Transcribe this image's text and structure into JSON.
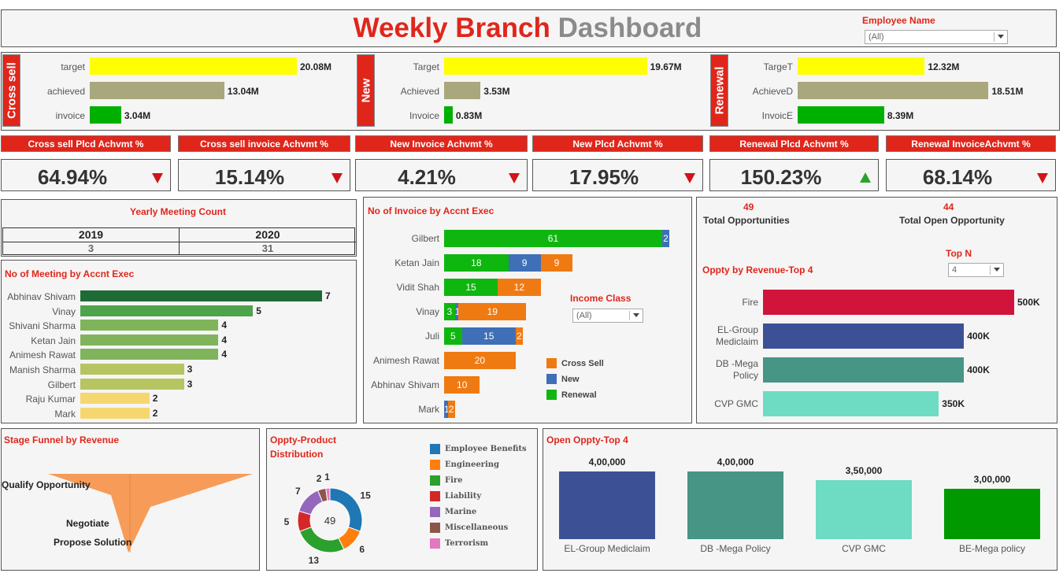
{
  "header": {
    "title_part1": "Weekly Branch",
    "title_part2": "Dashboard",
    "employee_label": "Employee Name",
    "employee_value": "(All)"
  },
  "groups": [
    {
      "label": "Cross sell",
      "rows": [
        {
          "name": "target",
          "value": "20.08M",
          "color": "#ffff00",
          "amount": 20.08
        },
        {
          "name": "achieved",
          "value": "13.04M",
          "color": "#a9a77c",
          "amount": 13.04
        },
        {
          "name": "invoice",
          "value": "3.04M",
          "color": "#00b000",
          "amount": 3.04
        }
      ]
    },
    {
      "label": "New",
      "rows": [
        {
          "name": "Target",
          "value": "19.67M",
          "color": "#ffff00",
          "amount": 19.67
        },
        {
          "name": "Achieved",
          "value": "3.53M",
          "color": "#a9a77c",
          "amount": 3.53
        },
        {
          "name": "Invoice",
          "value": "0.83M",
          "color": "#00b000",
          "amount": 0.83
        }
      ]
    },
    {
      "label": "Renewal",
      "rows": [
        {
          "name": "TargeT",
          "value": "12.32M",
          "color": "#ffff00",
          "amount": 12.32
        },
        {
          "name": "AchieveD",
          "value": "18.51M",
          "color": "#a9a77c",
          "amount": 18.51
        },
        {
          "name": "InvoicE",
          "value": "8.39M",
          "color": "#00b000",
          "amount": 8.39
        }
      ]
    }
  ],
  "kpis": [
    {
      "label": "Cross sell Plcd Achvmt %",
      "value": "64.94%",
      "trend": "down"
    },
    {
      "label": "Cross sell invoice Achvmt %",
      "value": "15.14%",
      "trend": "down"
    },
    {
      "label": "New Invoice Achvmt %",
      "value": "4.21%",
      "trend": "down"
    },
    {
      "label": "New Plcd Achvmt %",
      "value": "17.95%",
      "trend": "down"
    },
    {
      "label": "Renewal Plcd Achvmt %",
      "value": "150.23%",
      "trend": "up"
    },
    {
      "label": "Renewal InvoiceAchvmt %",
      "value": "68.14%",
      "trend": "down"
    }
  ],
  "yearly": {
    "title": "Yearly Meeting Count",
    "years": [
      "2019",
      "2020"
    ],
    "counts": [
      "3",
      "31"
    ]
  },
  "meetings": {
    "title": "No of Meeting by Accnt Exec",
    "rows": [
      {
        "name": "Abhinav Shivam",
        "value": 7,
        "color": "#1e6b35"
      },
      {
        "name": "Vinay",
        "value": 5,
        "color": "#4ea44a"
      },
      {
        "name": "Shivani Sharma",
        "value": 4,
        "color": "#80b45b"
      },
      {
        "name": "Ketan Jain",
        "value": 4,
        "color": "#80b45b"
      },
      {
        "name": "Animesh Rawat",
        "value": 4,
        "color": "#80b45b"
      },
      {
        "name": "Manish Sharma",
        "value": 3,
        "color": "#b6c562"
      },
      {
        "name": "Gilbert",
        "value": 3,
        "color": "#b6c562"
      },
      {
        "name": "Raju Kumar",
        "value": 2,
        "color": "#f6d76f"
      },
      {
        "name": "Mark",
        "value": 2,
        "color": "#f6d76f"
      }
    ]
  },
  "invoices": {
    "title": "No of Invoice by Accnt Exec",
    "income_label": "Income Class",
    "income_value": "(All)",
    "legend": [
      {
        "name": "Cross Sell",
        "color": "#f07a12"
      },
      {
        "name": "New",
        "color": "#3f6fb7"
      },
      {
        "name": "Renewal",
        "color": "#0fb60f"
      }
    ],
    "rows": [
      {
        "name": "Gilbert",
        "renewal": 61,
        "new": 2,
        "cross": 0
      },
      {
        "name": "Ketan Jain",
        "renewal": 18,
        "new": 9,
        "cross": 9
      },
      {
        "name": "Vidit Shah",
        "renewal": 15,
        "new": 0,
        "cross": 12
      },
      {
        "name": "Vinay",
        "renewal": 3,
        "new": 1,
        "cross": 19
      },
      {
        "name": "Juli",
        "renewal": 5,
        "new": 15,
        "cross": 2
      },
      {
        "name": "Animesh Rawat",
        "renewal": 0,
        "new": 0,
        "cross": 20
      },
      {
        "name": "Abhinav Shivam",
        "renewal": 0,
        "new": 0,
        "cross": 10
      },
      {
        "name": "Mark",
        "renewal": 0,
        "new": 1,
        "cross": 2
      }
    ]
  },
  "opps": {
    "total_value": "49",
    "total_label": "Total Opportunities",
    "open_value": "44",
    "open_label": "Total Open Opportunity",
    "topn_label": "Top N",
    "topn_value": "4",
    "revenue_title": "Oppty by Revenue-Top 4",
    "revenue_rows": [
      {
        "name1": "Fire",
        "name2": "",
        "value": "500K",
        "amount": 500,
        "color": "#d0143c"
      },
      {
        "name1": "EL-Group",
        "name2": "Mediclaim",
        "value": "400K",
        "amount": 400,
        "color": "#3c5195"
      },
      {
        "name1": "DB -Mega",
        "name2": "Policy",
        "value": "400K",
        "amount": 400,
        "color": "#469585"
      },
      {
        "name1": "CVP GMC",
        "name2": "",
        "value": "350K",
        "amount": 350,
        "color": "#6ddcc3"
      }
    ]
  },
  "funnel": {
    "title": "Stage Funnel by Revenue",
    "stages": [
      "Qualify Opportunity",
      "Negotiate",
      "Propose Solution"
    ]
  },
  "donut": {
    "title_line1": "Oppty-Product",
    "title_line2": "Distribution",
    "center": "49",
    "slices": [
      {
        "name": "Employee Benefits",
        "value": 15,
        "color": "#1f77b4"
      },
      {
        "name": "Engineering",
        "value": 6,
        "color": "#ff7f0e"
      },
      {
        "name": "Fire",
        "value": 13,
        "color": "#2ca02c"
      },
      {
        "name": "Liability",
        "value": 5,
        "color": "#d62728"
      },
      {
        "name": "Marine",
        "value": 7,
        "color": "#9467bd"
      },
      {
        "name": "Miscellaneous",
        "value": 2,
        "color": "#8c564b"
      },
      {
        "name": "Terrorism",
        "value": 1,
        "color": "#e377c2"
      }
    ]
  },
  "open_top": {
    "title": "Open Oppty-Top 4",
    "bars": [
      {
        "name": "EL-Group Mediclaim",
        "label": "4,00,000",
        "value": 400000,
        "color": "#3c5195"
      },
      {
        "name": "DB -Mega Policy",
        "label": "4,00,000",
        "value": 400000,
        "color": "#469585"
      },
      {
        "name": "CVP GMC",
        "label": "3,50,000",
        "value": 350000,
        "color": "#6ddcc3"
      },
      {
        "name": "BE-Mega policy",
        "label": "3,00,000",
        "value": 300000,
        "color": "#009a00"
      }
    ]
  }
}
